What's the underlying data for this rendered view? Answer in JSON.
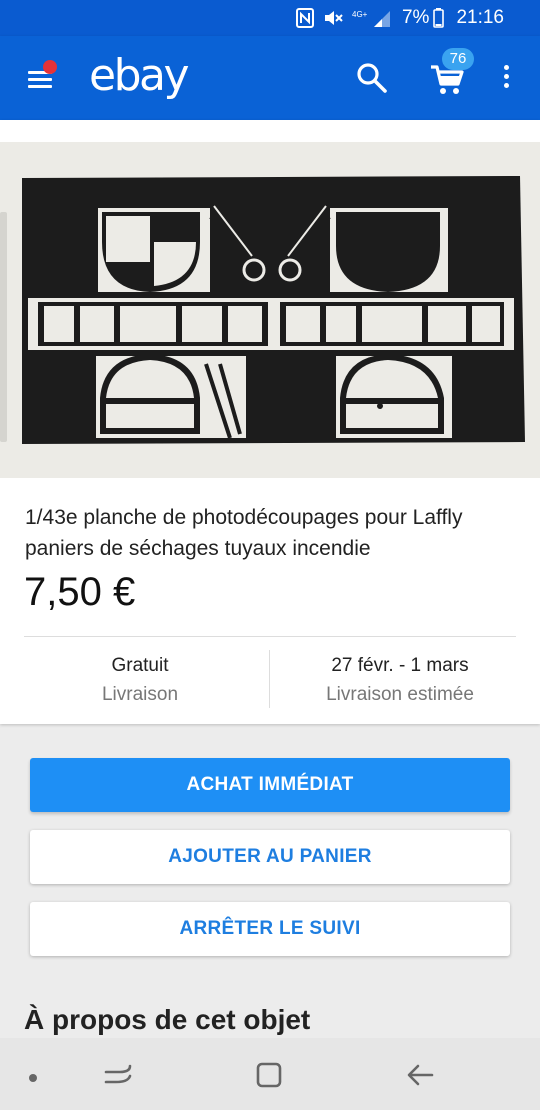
{
  "status_bar": {
    "battery": "7%",
    "time": "21:16"
  },
  "header": {
    "logo": "ebay",
    "cart_count": "76"
  },
  "listing": {
    "title": "1/43e planche de photodécoupages pour Laffly paniers de séchages tuyaux incendie",
    "price": "7,50 €",
    "shipping_value": "Gratuit",
    "shipping_label": "Livraison",
    "delivery_value": "27 févr. - 1 mars",
    "delivery_label": "Livraison estimée"
  },
  "actions": {
    "buy_now": "ACHAT IMMÉDIAT",
    "add_to_cart": "AJOUTER AU PANIER",
    "unwatch": "ARRÊTER LE SUIVI"
  },
  "section": {
    "about": "À propos de cet objet"
  },
  "colors": {
    "app_bar": "#0a62d6",
    "primary_button": "#1e8ff5",
    "link_text": "#1e7ee0",
    "notification_dot": "#e53238",
    "badge": "#3aa3f0"
  },
  "icons": [
    "nfc-icon",
    "mute-icon",
    "signal-icon",
    "battery-icon",
    "menu-icon",
    "search-icon",
    "cart-icon",
    "more-vert-icon",
    "nav-dot-icon",
    "recent-apps-icon",
    "home-icon",
    "back-icon"
  ]
}
